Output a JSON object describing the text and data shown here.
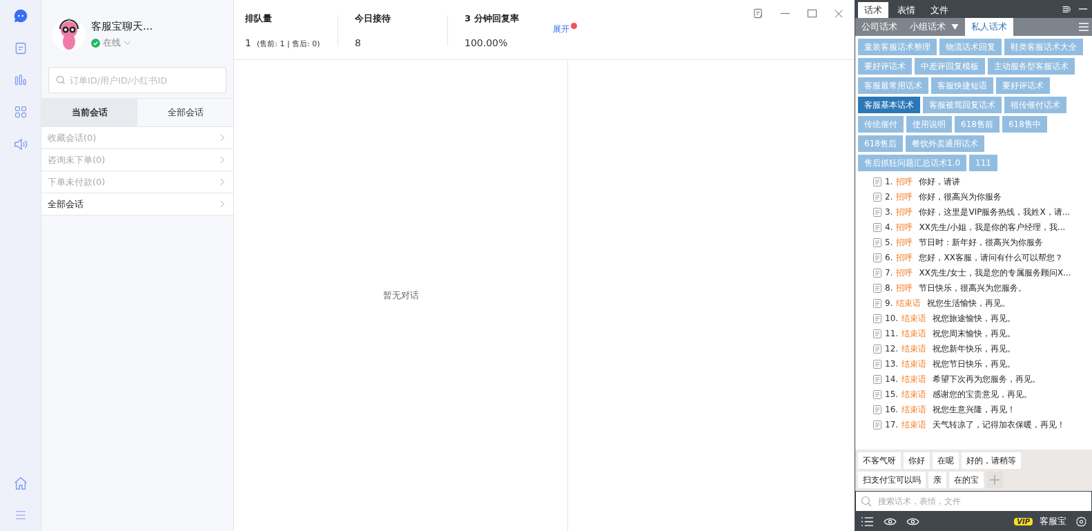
{
  "profile": {
    "name": "客服宝聊天...",
    "status": "在线"
  },
  "search": {
    "placeholder": "订单ID/用户ID/小红书ID"
  },
  "session_tabs": [
    {
      "label": "当前会话",
      "selected": true
    },
    {
      "label": "全部会话",
      "selected": false
    }
  ],
  "session_filters": [
    {
      "label": "收藏会话(0)",
      "selected": false
    },
    {
      "label": "咨询未下单(0)",
      "selected": false
    },
    {
      "label": "下单未付款(0)",
      "selected": false
    },
    {
      "label": "全部会话",
      "selected": true
    }
  ],
  "stats": [
    {
      "title": "排队量",
      "value": "1",
      "detail": "(售前: 1 | 售后: 0)"
    },
    {
      "title": "今日接待",
      "value": "8"
    },
    {
      "title": "3 分钟回复率",
      "value": "100.00%"
    }
  ],
  "expand_link": {
    "label": "展开",
    "has_dot": true
  },
  "empty_text": "暂无对话",
  "panel_tabs": [
    {
      "label": "话术",
      "selected": true
    },
    {
      "label": "表情",
      "selected": false
    },
    {
      "label": "文件",
      "selected": false
    }
  ],
  "sub_tabs": [
    {
      "label": "公司话术",
      "selected": false,
      "dropdown": false
    },
    {
      "label": "小组话术",
      "selected": false,
      "dropdown": true
    },
    {
      "label": "私人话术",
      "selected": true,
      "dropdown": false
    }
  ],
  "categories": [
    {
      "label": "童装客服话术整理",
      "selected": false
    },
    {
      "label": "物流话术回复",
      "selected": false
    },
    {
      "label": "鞋类客服话术大全",
      "selected": false
    },
    {
      "label": "要好评话术",
      "selected": false
    },
    {
      "label": "中差评回复模板",
      "selected": false
    },
    {
      "label": "主动服务型客服话术",
      "selected": false
    },
    {
      "label": "客服最常用话术",
      "selected": false
    },
    {
      "label": "客服快捷短语",
      "selected": false
    },
    {
      "label": "要好评话术",
      "selected": false
    },
    {
      "label": "客服基本话术",
      "selected": true
    },
    {
      "label": "客服被骂回复话术",
      "selected": false
    },
    {
      "label": "祖传催付话术",
      "selected": false
    },
    {
      "label": "传统催付",
      "selected": false
    },
    {
      "label": "使用说明",
      "selected": false
    },
    {
      "label": "618售前",
      "selected": false
    },
    {
      "label": "618售中",
      "selected": false
    },
    {
      "label": "618售后",
      "selected": false
    },
    {
      "label": "餐饮外卖通用话术",
      "selected": false
    },
    {
      "label": "售后抓狂问题汇总话术1.0",
      "selected": false
    },
    {
      "label": "111",
      "selected": false
    }
  ],
  "scripts": [
    {
      "number": "1.",
      "tag": "招呼",
      "text": "你好，请讲"
    },
    {
      "number": "2.",
      "tag": "招呼",
      "text": "你好，很高兴为你服务"
    },
    {
      "number": "3.",
      "tag": "招呼",
      "text": "你好，这里是VIP服务热线，我姓X，请..."
    },
    {
      "number": "4.",
      "tag": "招呼",
      "text": "XX先生/小姐，我是你的客户经理，我..."
    },
    {
      "number": "5.",
      "tag": "招呼",
      "text": "节日时：新年好，很高兴为你服务"
    },
    {
      "number": "6.",
      "tag": "招呼",
      "text": "您好，XX客服，请问有什么可以帮您？"
    },
    {
      "number": "7.",
      "tag": "招呼",
      "text": "XX先生/女士，我是您的专属服务顾问X..."
    },
    {
      "number": "8.",
      "tag": "招呼",
      "text": "节日快乐，很高兴为您服务。"
    },
    {
      "number": "9.",
      "tag": "结束语",
      "text": "祝您生活愉快，再见。"
    },
    {
      "number": "10.",
      "tag": "结束语",
      "text": "祝您旅途愉快，再见。"
    },
    {
      "number": "11.",
      "tag": "结束语",
      "text": "祝您周末愉快，再见。"
    },
    {
      "number": "12.",
      "tag": "结束语",
      "text": "祝您新年快乐，再见。"
    },
    {
      "number": "13.",
      "tag": "结束语",
      "text": "祝您节日快乐，再见。"
    },
    {
      "number": "14.",
      "tag": "结束语",
      "text": "希望下次再为您服务，再见。"
    },
    {
      "number": "15.",
      "tag": "结束语",
      "text": "感谢您的宝贵意见，再见。"
    },
    {
      "number": "16.",
      "tag": "结束语",
      "text": "祝您生意兴隆，再见！"
    },
    {
      "number": "17.",
      "tag": "结束语",
      "text": "天气转凉了，记得加衣保暖，再见！"
    }
  ],
  "quick_phrases": [
    "不客气呀",
    "你好",
    "在呢",
    "好的，请稍等",
    "扫支付宝可以吗",
    "亲",
    "在的宝"
  ],
  "panel_search": {
    "placeholder": "搜索话术，表情，文件"
  },
  "footer": {
    "brand": "客服宝",
    "vip": "VIP"
  }
}
